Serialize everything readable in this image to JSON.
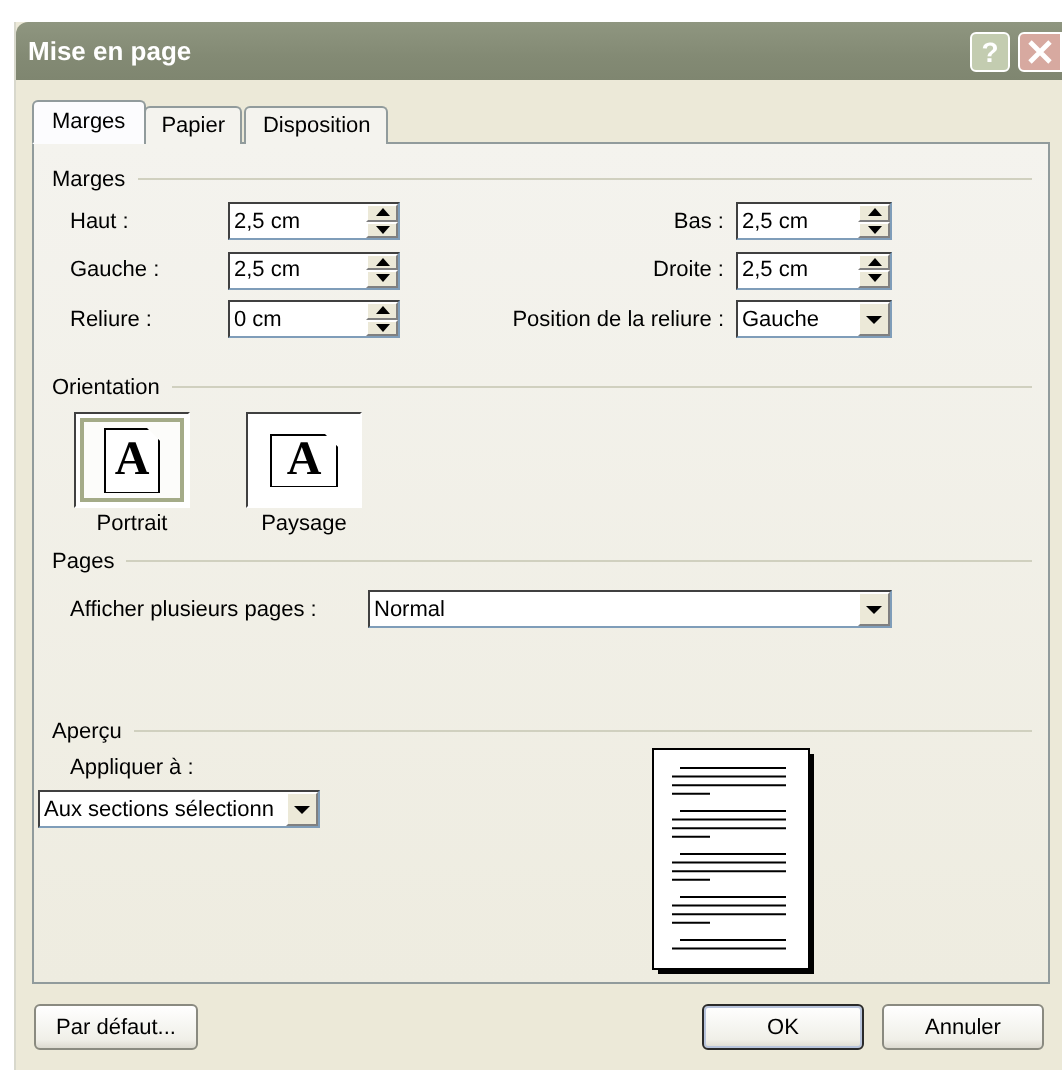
{
  "window": {
    "title": "Mise en page",
    "help_button": "?"
  },
  "tabs": [
    {
      "label": "Marges",
      "selected": true
    },
    {
      "label": "Papier",
      "selected": false
    },
    {
      "label": "Disposition",
      "selected": false
    }
  ],
  "margins": {
    "title": "Marges",
    "left_fields": [
      {
        "label": "Haut :",
        "value": "2,5 cm",
        "kind": "spin"
      },
      {
        "label": "Gauche :",
        "value": "2,5 cm",
        "kind": "spin"
      },
      {
        "label": "Reliure :",
        "value": "0 cm",
        "kind": "spin"
      }
    ],
    "right_fields": [
      {
        "label": "Bas :",
        "value": "2,5 cm",
        "kind": "spin"
      },
      {
        "label": "Droite :",
        "value": "2,5 cm",
        "kind": "spin"
      },
      {
        "label": "Position de la reliure :",
        "value": "Gauche",
        "kind": "combo"
      }
    ]
  },
  "orientation": {
    "title": "Orientation",
    "options": [
      {
        "label": "Portrait",
        "glyph": "A",
        "kind": "portrait",
        "selected": true
      },
      {
        "label": "Paysage",
        "glyph": "A",
        "kind": "landscape",
        "selected": false
      }
    ]
  },
  "pages": {
    "title": "Pages",
    "label": "Afficher plusieurs pages :",
    "value": "Normal"
  },
  "preview": {
    "title": "Aperçu",
    "apply_label": "Appliquer à :",
    "apply_value": "Aux sections sélectionn"
  },
  "buttons": [
    {
      "label": "Par défaut...",
      "is_default": false
    },
    {
      "label": "OK",
      "is_default": true
    },
    {
      "label": "Annuler",
      "is_default": false
    }
  ]
}
